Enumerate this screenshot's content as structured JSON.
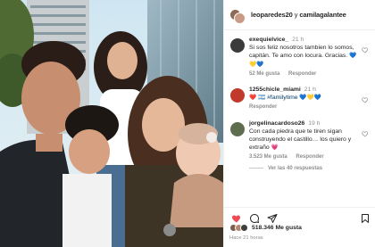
{
  "post": {
    "header_user1": "leoparedes20",
    "header_and": "y",
    "header_user2": "camilagalantee"
  },
  "comments": [
    {
      "user": "exequielvice_",
      "time": "21 h",
      "text": "Si sos feliz nosotros tambien lo somos, capitán. Te amo con locura. Gracias.",
      "emojis": "💙💛💙",
      "likes": "52 Me gusta",
      "reply": "Responder",
      "avatar_color": "#3b3b3b"
    },
    {
      "user": "1255chicle_miami",
      "time": "21 h",
      "prefix_emojis": "❤️ 🇦🇷",
      "hashtag": "#familytime",
      "emojis": "💙💛💙",
      "reply": "Responder",
      "avatar_color": "#c0392b"
    },
    {
      "user": "jorgelinacardoso26",
      "time": "19 h",
      "text": "Con cada piedra que te tiren sigan construyendo el castillo… los quiero y extraño",
      "emojis": "💗",
      "likes": "3.523 Me gusta",
      "reply": "Responder",
      "avatar_color": "#5d6d4e"
    }
  ],
  "view_replies": "Ver las 40 respuestas",
  "likes_summary": {
    "count": "518.346",
    "label": "Me gusta"
  },
  "time_ago": "Hace 21 horas",
  "icons": {
    "like": "heart-filled-icon",
    "comment": "comment-bubble-icon",
    "share": "paper-plane-icon",
    "save": "bookmark-icon",
    "comment_like": "heart-outline-icon"
  },
  "colors": {
    "like_red": "#ed4956",
    "link_blue": "#00376b",
    "muted_gray": "#8e8e8e"
  }
}
